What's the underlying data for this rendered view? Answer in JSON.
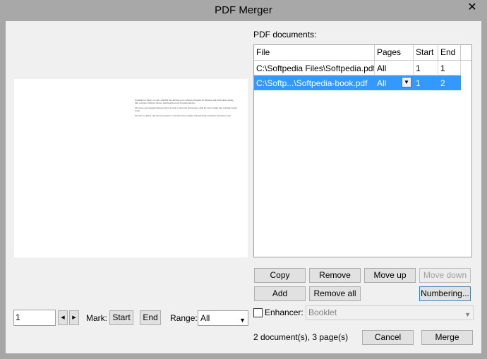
{
  "window": {
    "title": "PDF Merger",
    "close_glyph": "✕"
  },
  "preview": {
    "paragraphs": [
      "Softpedia is a library of over 1,000,000 free and free-to-try software programs for Windows and Unix/Linux, games, Mac software, Windows drivers, mobile devices and IT-related articles.",
      "We review and categorize these products in order to allow the visitor/user to find the exact product they and their system needs.",
      "We strive to deliver only the best products to the visitor/user together with self-made evaluation and review notes."
    ]
  },
  "documents": {
    "label": "PDF documents:",
    "columns": [
      "File",
      "Pages",
      "Start",
      "End"
    ],
    "rows": [
      {
        "file": "C:\\Softpedia Files\\Softpedia.pdf",
        "pages": "All",
        "start": "1",
        "end": "1"
      },
      {
        "file": "C:\\Softp...\\Softpedia-book.pdf",
        "pages": "All",
        "start": "1",
        "end": "2"
      }
    ]
  },
  "buttons": {
    "copy": "Copy",
    "remove": "Remove",
    "move_up": "Move up",
    "move_down": "Move down",
    "add": "Add",
    "remove_all": "Remove all",
    "numbering": "Numbering...",
    "cancel": "Cancel",
    "merge": "Merge"
  },
  "enhancer": {
    "label": "Enhancer:",
    "value": "Booklet"
  },
  "page_nav": {
    "page_value": "1",
    "mark_label": "Mark:",
    "start_label": "Start",
    "end_label": "End",
    "range_label": "Range:",
    "range_value": "All"
  },
  "status": "2 document(s), 3 page(s)",
  "colors": {
    "selection": "#3399ff",
    "frame": "#a8a8a8"
  }
}
